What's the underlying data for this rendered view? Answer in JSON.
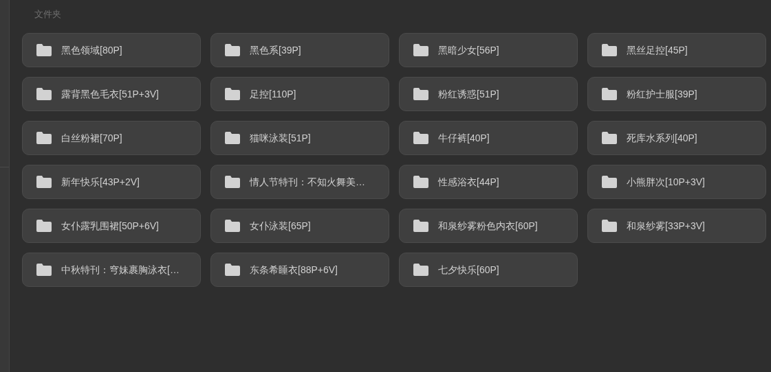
{
  "section_title": "文件夹",
  "folders": [
    {
      "name": "黑色领域[80P]"
    },
    {
      "name": "黑色系[39P]"
    },
    {
      "name": "黑暗少女[56P]"
    },
    {
      "name": "黑丝足控[45P]"
    },
    {
      "name": "露背黑色毛衣[51P+3V]"
    },
    {
      "name": "足控[110P]"
    },
    {
      "name": "粉红诱惑[51P]"
    },
    {
      "name": "粉红护士服[39P]"
    },
    {
      "name": "白丝粉裙[70P]"
    },
    {
      "name": "猫咪泳装[51P]"
    },
    {
      "name": "牛仔裤[40P]"
    },
    {
      "name": "死库水系列[40P]"
    },
    {
      "name": "新年快乐[43P+2V]"
    },
    {
      "name": "情人节特刊：不知火舞美…"
    },
    {
      "name": "性感浴衣[44P]"
    },
    {
      "name": "小熊胖次[10P+3V]"
    },
    {
      "name": "女仆露乳围裙[50P+6V]"
    },
    {
      "name": "女仆泳装[65P]"
    },
    {
      "name": "和泉纱雾粉色内衣[60P]"
    },
    {
      "name": "和泉纱雾[33P+3V]"
    },
    {
      "name": "中秋特刊：穹妹裹胸泳衣[…"
    },
    {
      "name": "东条希睡衣[88P+6V]"
    },
    {
      "name": "七夕快乐[60P]"
    }
  ]
}
